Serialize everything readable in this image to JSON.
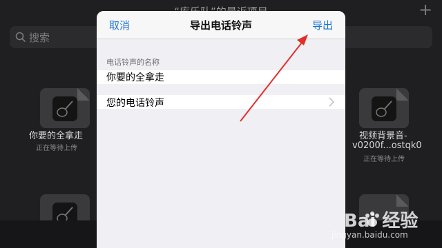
{
  "background": {
    "title": "“库乐队”的最近项目",
    "search_placeholder": "搜索",
    "tiles": [
      {
        "name": "你要的全拿走",
        "status": "正在等待上传"
      },
      {
        "name": "视频背景音-",
        "name2": "v0200f...ostqk0",
        "status": "正在等待上传"
      }
    ]
  },
  "sheet": {
    "cancel_label": "取消",
    "title": "导出电话铃声",
    "export_label": "导出",
    "section_header": "电话铃声的名称",
    "ringtone_name_value": "你要的全拿走",
    "ringtone_row_label": "您的电话铃声"
  },
  "watermark": {
    "line1": "Bai 经验",
    "line2": "jingyan.baidu.com"
  },
  "colors": {
    "accent": "#1a73d9",
    "annotation_arrow": "#e0302a",
    "sheet_bg": "#efeff4",
    "app_bg": "#1f1f21"
  },
  "icons": {
    "search": "search-icon",
    "plus": "plus-icon",
    "chevron": "chevron-right-icon",
    "guitar": "guitar-icon"
  }
}
